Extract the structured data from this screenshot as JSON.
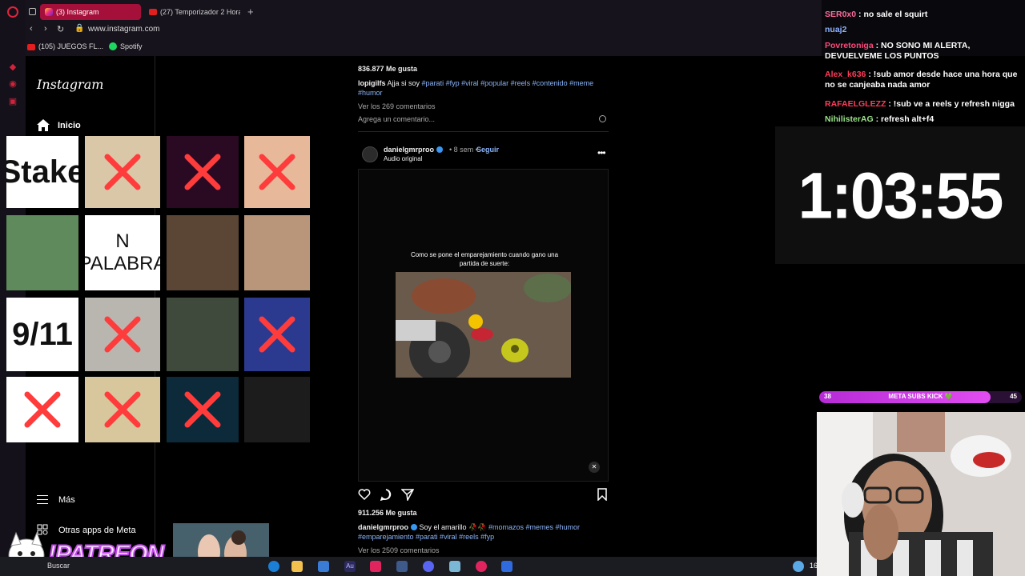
{
  "browser": {
    "tabs": [
      {
        "label": "(3) Instagram"
      },
      {
        "label": "(27) Temporizador 2 Hora"
      }
    ],
    "address": "www.instagram.com",
    "bookmarks": [
      {
        "label": "(105) JUEGOS FL..."
      },
      {
        "label": "Spotify"
      }
    ]
  },
  "instagram": {
    "logo": "Instagram",
    "nav": {
      "home": "Inicio",
      "more": "Más",
      "meta_apps": "Otras apps de Meta"
    },
    "post1": {
      "likes": "836.877 Me gusta",
      "user": "lopigilfs",
      "caption": "Ajja si soy",
      "tags": "#parati #fyp #viral #popular #reels #contenido #meme #humor",
      "comments": "Ver los 269 comentarios",
      "add_comment": "Agrega un comentario..."
    },
    "post2": {
      "user": "danielgmrproo",
      "age": "• 8 sem •",
      "follow": "Seguir",
      "audio": "Audio original",
      "video_caption": "Como se pone el emparejamiento cuando gano una partida de suerte:",
      "likes": "911.256 Me gusta",
      "caption": "Soy el amarillo 🥀🥀",
      "tags": "#momazos #memes #humor #emparejamiento #parati #viral #reels #fyp",
      "comments": "Ver los 2509 comentarios"
    }
  },
  "soundboard": {
    "tiles": [
      {
        "name": "stake",
        "text": "Stake",
        "crossed": false,
        "bg": "#ffffff"
      },
      {
        "name": "hands",
        "text": "",
        "crossed": true,
        "bg": "#d9c7a8"
      },
      {
        "name": "monster",
        "text": "",
        "crossed": true,
        "bg": "#2a0a22"
      },
      {
        "name": "child",
        "text": "",
        "crossed": true,
        "bg": "#e8b89a"
      },
      {
        "name": "shark",
        "text": "",
        "crossed": false,
        "bg": "#5f8a5c"
      },
      {
        "name": "n-palabra",
        "text": "N\nPALABRA",
        "crossed": false,
        "bg": "#ffffff"
      },
      {
        "name": "man-portrait",
        "text": "",
        "crossed": false,
        "bg": "#5b4636"
      },
      {
        "name": "old-man",
        "text": "",
        "crossed": false,
        "bg": "#b99679"
      },
      {
        "name": "nine-eleven",
        "text": "9/11",
        "crossed": false,
        "bg": "#ffffff"
      },
      {
        "name": "cat",
        "text": "",
        "crossed": true,
        "bg": "#b9b6b0"
      },
      {
        "name": "dancer",
        "text": "",
        "crossed": false,
        "bg": "#3f4a3d"
      },
      {
        "name": "blue-figure",
        "text": "",
        "crossed": true,
        "bg": "#2b3a8f"
      },
      {
        "name": "amogus",
        "text": "",
        "crossed": true,
        "bg": "#ffffff"
      },
      {
        "name": "tacos",
        "text": "",
        "crossed": true,
        "bg": "#d8c69c"
      },
      {
        "name": "blue-orb",
        "text": "",
        "crossed": true,
        "bg": "#0c2a3a"
      },
      {
        "name": "dark-girl",
        "text": "",
        "crossed": false,
        "bg": "#1c1c1c"
      }
    ]
  },
  "chat": {
    "messages": [
      {
        "user": "SER0x0",
        "text": ": no sale el squirt",
        "color": "#ff6b9d"
      },
      {
        "user": "nuaj2",
        "text": "",
        "color": "#8fb3ff"
      },
      {
        "user": "Povretoniga",
        "text": ": NO SONO MI ALERTA, DEVUELVEME LOS PUNTOS",
        "color": "#ff4a7a"
      },
      {
        "user": "Alex_k636",
        "text": ": !sub amor desde hace una hora que no se canjeaba nada amor",
        "color": "#ff3c5a"
      },
      {
        "user": "RAFAELGLEZZ",
        "text": ": !sub ve a reels y refresh nigga",
        "color": "#ff3c5a"
      },
      {
        "user": "NihilisterAG",
        "text": ": refresh alt+f4",
        "color": "#9be38b"
      }
    ]
  },
  "timer": "1:03:55",
  "subs_goal": {
    "current": "38",
    "label": "META SUBS KICK 💚",
    "goal": "45",
    "progress": 0.844
  },
  "patreon": "!PATREON",
  "taskbar": {
    "search": "Buscar",
    "clock": "16"
  }
}
